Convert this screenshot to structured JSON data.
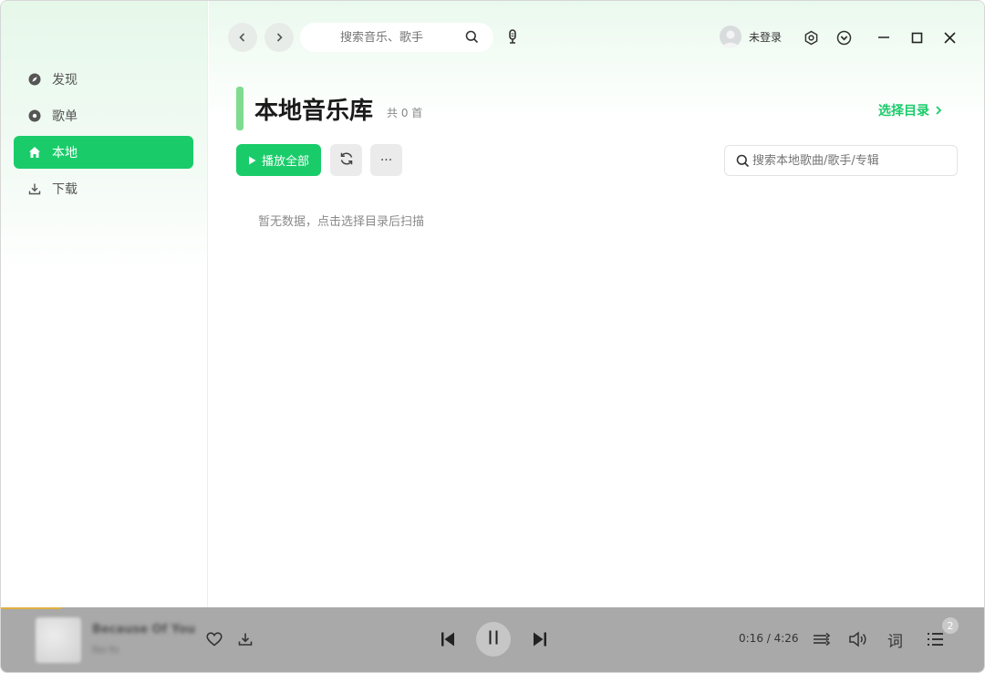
{
  "sidebar": {
    "items": [
      {
        "label": "发现",
        "icon": "compass-icon"
      },
      {
        "label": "歌单",
        "icon": "disc-icon"
      },
      {
        "label": "本地",
        "icon": "home-icon",
        "active": true
      },
      {
        "label": "下载",
        "icon": "download-icon"
      }
    ]
  },
  "topbar": {
    "search_placeholder": "搜索音乐、歌手",
    "user_label": "未登录"
  },
  "page": {
    "title": "本地音乐库",
    "count": "共 0 首",
    "select_dir": "选择目录",
    "play_all": "播放全部",
    "more": "···",
    "local_search_placeholder": "搜索本地歌曲/歌手/专辑",
    "empty_text": "暂无数据，点击选择目录后扫描"
  },
  "player": {
    "song_title": "Because Of You",
    "song_artist": "Ne-Yo",
    "time": "0:16 / 4:26",
    "lyric_label": "词",
    "queue_count": "2"
  },
  "colors": {
    "accent": "#19cc69",
    "player_bg": "#a9a9a9"
  }
}
